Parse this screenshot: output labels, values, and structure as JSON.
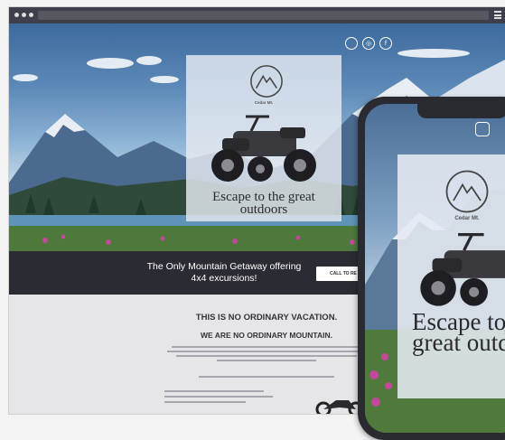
{
  "site": {
    "brand": "Cedar Mt.",
    "social_icons": [
      "circle-icon",
      "instagram-icon",
      "facebook-icon"
    ],
    "social_glyphs": [
      "",
      "◎",
      "f"
    ]
  },
  "hero": {
    "headline": "Escape to the great outdoors"
  },
  "banner": {
    "text": "The Only Mountain Getaway offering 4x4 excursions!",
    "cta_label": "CALL TO RE"
  },
  "intro": {
    "heading": "THIS IS NO ORDINARY VACATION.",
    "subheading": "WE ARE NO ORDINARY MOUNTAIN."
  },
  "phone": {
    "brand": "Cedar Mt.",
    "headline": "Escape to the great outdoors"
  },
  "colors": {
    "banner_bg": "#2b2b33",
    "card_bg": "#e6ebf2",
    "chrome_bg": "#3d3f4a"
  }
}
